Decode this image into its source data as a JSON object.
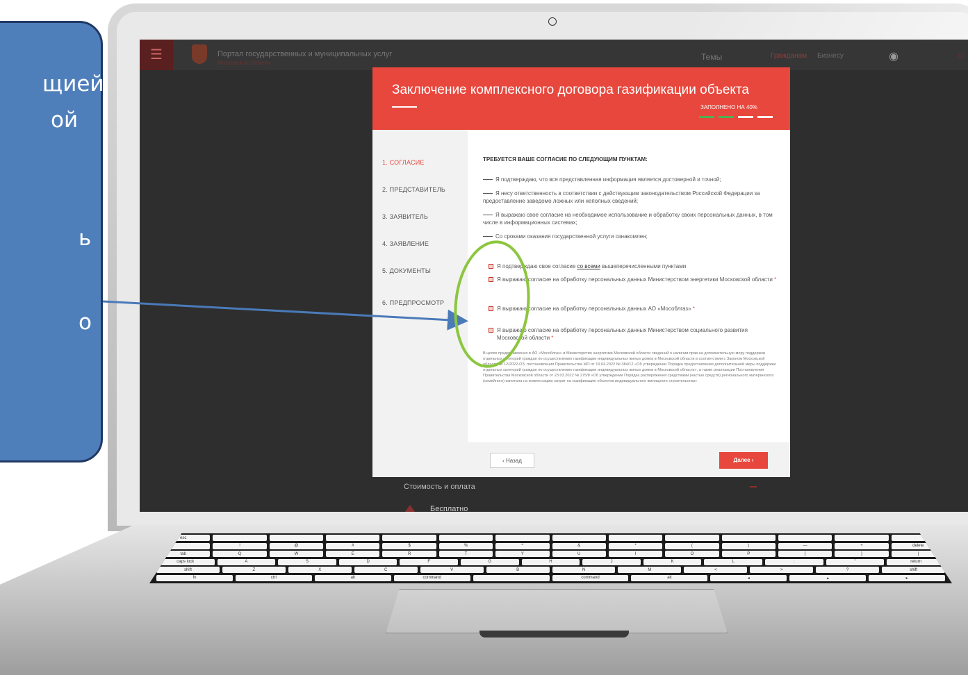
{
  "callout": {
    "lines": [
      "щией",
      "ой",
      "ь",
      "о"
    ]
  },
  "portal": {
    "title": "Портал государственных и муниципальных услуг",
    "subtitle": "Московской области",
    "topics": "Темы",
    "audience_citizens": "Гражданам",
    "audience_business": "Бизнесу"
  },
  "modal": {
    "title": "Заключение комплексного договора газификации объекта",
    "progress_label": "ЗАПОЛНЕНО НА 40%",
    "progress": 0.4,
    "progress_segments": 4,
    "steps": [
      {
        "label": "1.  СОГЛАСИЕ",
        "active": true
      },
      {
        "label": "2.  ПРЕДСТАВИТЕЛЬ",
        "active": false
      },
      {
        "label": "3.  ЗАЯВИТЕЛЬ",
        "active": false
      },
      {
        "label": "4.  ЗАЯВЛЕНИЕ",
        "active": false
      },
      {
        "label": "5.  ДОКУМЕНТЫ",
        "active": false
      },
      {
        "label": "6.  ПРЕДПРОСМОТР",
        "active": false
      }
    ],
    "consent_heading": "ТРЕБУЕТСЯ ВАШЕ СОГЛАСИЕ ПО СЛЕДУЮЩИМ ПУНКТАМ:",
    "statements": [
      "Я подтверждаю, что вся представленная информация является достоверной и точной;",
      "Я несу ответственность в соответствии с действующим законодательством Российской Федерации за предоставление заведомо ложных или неполных сведений;",
      "Я выражаю свое согласие на необходимое использование и обработку своих персональных данных, в том числе в информационных системах;",
      "Со сроками оказания государственной услуги ознакомлен;"
    ],
    "checkbox_all_before": "Я подтверждаю свое согласие ",
    "checkbox_all_link": "со всеми",
    "checkbox_all_after": " вышеперечисленными пунктами",
    "checkboxes": [
      "Я выражаю согласие на обработку персональных данных Министерством энергетики Московской области",
      "Я выражаю согласие на обработку персональных данных АО «Мособлгаз»",
      "Я выражаю согласие на обработку персональных данных Министерством социального развития Московской области"
    ],
    "required_mark": "*",
    "legal_text": "В целях предоставления в АО «Мособлгаз» и Министерство энергетики Московской области сведений о наличии прав на дополнительную меру поддержки отдельных категорий граждан по осуществлению газификации индивидуальных жилых домов в Московской области в соответствии с Законом Московской области № 12/2022-ОЗ, постановления Правительства МО от 19.04.2022 № 384/12 «Об утверждении Порядка предоставления дополнительной меры поддержки отдельных категорий граждан по осуществлению газификации индивидуальных жилых домов в Московской области», а также реализации Постановления Правительства Московской области от 23.03.2022 № 275/8 «Об утверждении Порядка распоряжения средствами (частью средств) регионального материнского (семейного) капитала на компенсацию затрат на газификацию объектов индивидуального жилищного строительства»",
    "back_label": "‹ Назад",
    "next_label": "Далее ›"
  },
  "below": {
    "cost_label": "Стоимость и оплата",
    "free_label": "Бесплатно"
  },
  "colors": {
    "accent": "#e8473d",
    "progress_done": "#4caf50",
    "callout_fill": "#4f7fbb",
    "callout_border": "#1f3864",
    "arrow": "#4a7ab8",
    "highlight_circle": "#8cc63f"
  },
  "keyboard": {
    "rows": [
      [
        "esc",
        "",
        "",
        "",
        "",
        "",
        "",
        "",
        "",
        "",
        "",
        "",
        "",
        ""
      ],
      [
        "",
        "!",
        "@",
        "#",
        "$",
        "%",
        "^",
        "&",
        "*",
        "(",
        ")",
        "—",
        "+",
        "delete"
      ],
      [
        "tab",
        "Q",
        "W",
        "E",
        "R",
        "T",
        "Y",
        "U",
        "I",
        "O",
        "P",
        "{",
        "}",
        "|"
      ],
      [
        "caps lock",
        "A",
        "S",
        "D",
        "F",
        "G",
        "H",
        "J",
        "K",
        "L",
        ":",
        "\"",
        "return"
      ],
      [
        "shift",
        "Z",
        "X",
        "C",
        "V",
        "B",
        "N",
        "M",
        "<",
        ">",
        "?",
        "shift"
      ],
      [
        "fn",
        "ctrl",
        "alt",
        "command",
        "",
        "command",
        "alt",
        "◂",
        "▴",
        "▸"
      ]
    ]
  }
}
